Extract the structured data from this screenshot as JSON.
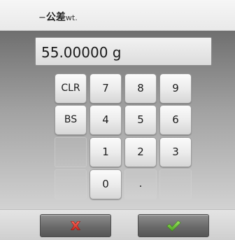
{
  "title": {
    "prefix": "−",
    "main": "公差",
    "unit": "wt."
  },
  "display": {
    "value": "55.00000 g"
  },
  "keys": {
    "clr": "CLR",
    "bs": "BS",
    "k7": "7",
    "k8": "8",
    "k9": "9",
    "k4": "4",
    "k5": "5",
    "k6": "6",
    "k1": "1",
    "k2": "2",
    "k3": "3",
    "k0": "0",
    "dot": "."
  },
  "actions": {
    "cancel_icon": "cancel-x-icon",
    "confirm_icon": "confirm-check-icon"
  },
  "colors": {
    "cancel": "#e03a2f",
    "confirm": "#6cc13a"
  }
}
